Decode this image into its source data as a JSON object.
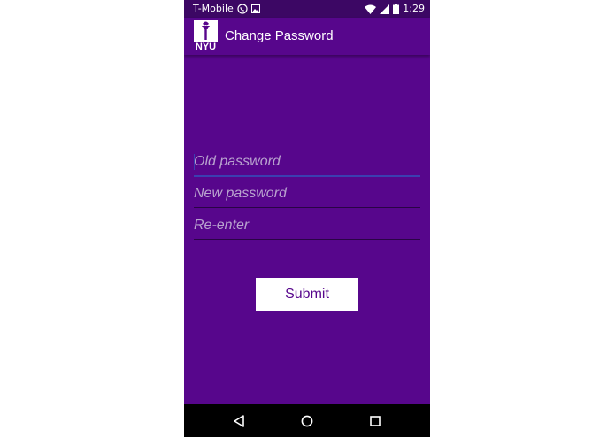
{
  "status_bar": {
    "carrier": "T-Mobile",
    "time": "1:29",
    "icons": [
      "whatsapp-icon",
      "image-icon",
      "wifi-icon",
      "signal-icon",
      "battery-icon"
    ]
  },
  "app_bar": {
    "logo_text": "NYU",
    "title": "Change Password"
  },
  "form": {
    "old_password": {
      "placeholder": "Old password",
      "value": ""
    },
    "new_password": {
      "placeholder": "New password",
      "value": ""
    },
    "reenter": {
      "placeholder": "Re-enter",
      "value": ""
    },
    "submit_label": "Submit"
  },
  "nav_bar": {
    "icons": [
      "back-icon",
      "home-icon",
      "recents-icon"
    ]
  },
  "colors": {
    "primary": "#57068c",
    "status_bar": "#3c0764",
    "accent": "#3b3fb0",
    "hint": "#b9a3cf"
  }
}
